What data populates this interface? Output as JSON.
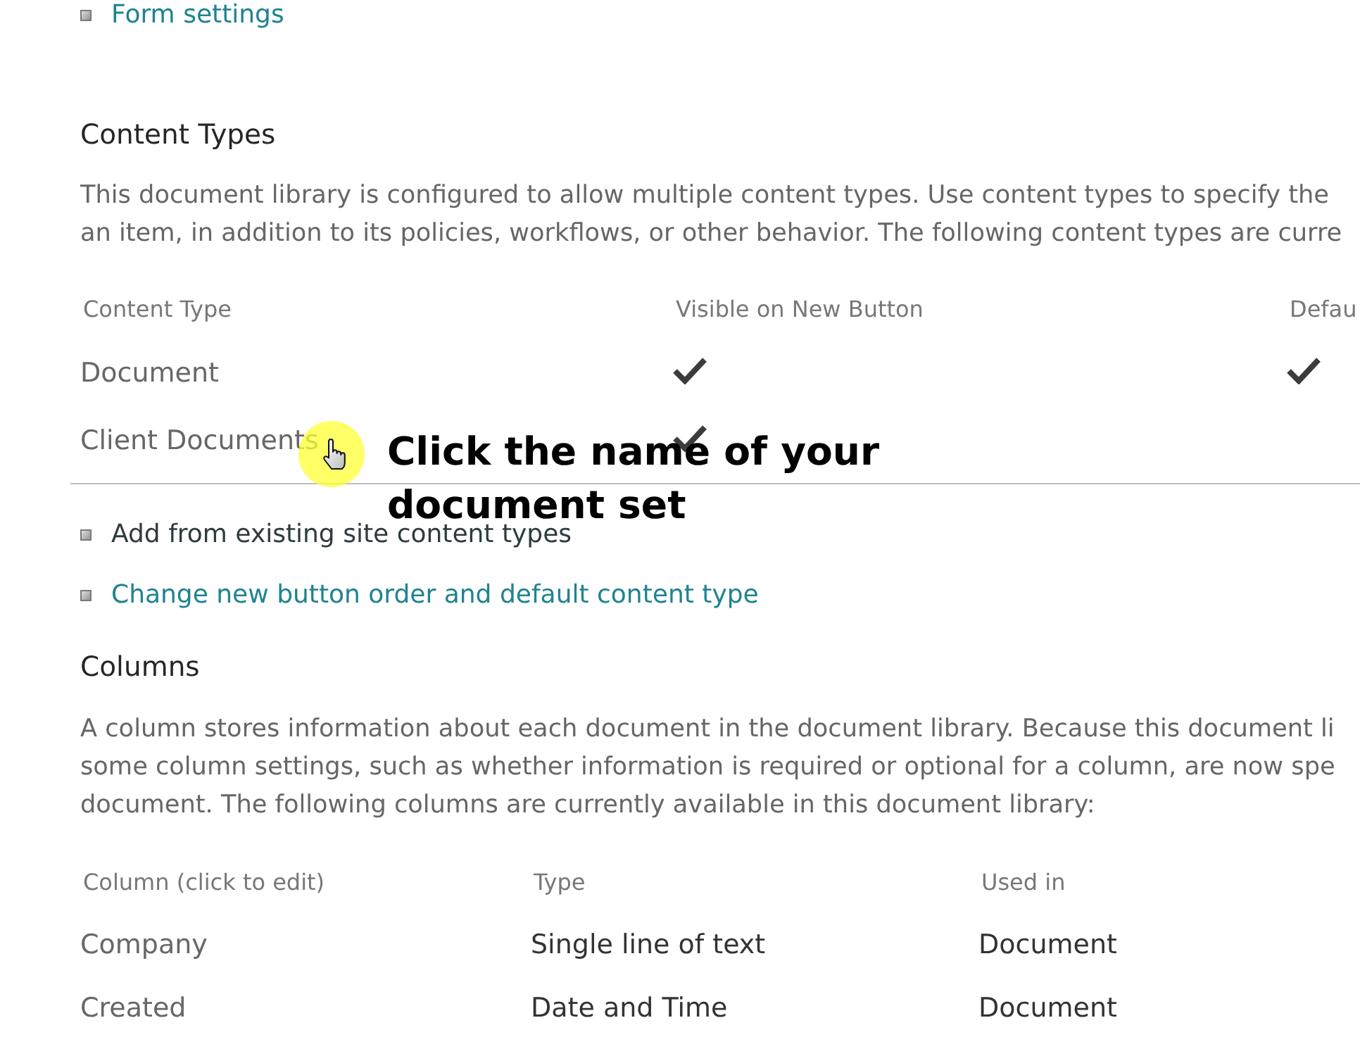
{
  "form_settings_link": {
    "label": "Form settings",
    "visited": false
  },
  "content_types": {
    "heading": "Content Types",
    "description_lines": [
      "This document library is configured to allow multiple content types. Use content types to specify the",
      "an item, in addition to its policies, workflows, or other behavior. The following content types are curre"
    ],
    "table": {
      "columns": [
        "Content Type",
        "Visible on New Button",
        "Defau"
      ],
      "rows": [
        {
          "name": "Document",
          "visible_on_new_button": true,
          "default": true
        },
        {
          "name": "Client Documents",
          "visible_on_new_button": true,
          "default": false
        }
      ]
    },
    "links": [
      {
        "label": "Add from existing site content types",
        "visited": true
      },
      {
        "label": "Change new button order and default content type",
        "visited": false
      }
    ]
  },
  "callout": {
    "text": "Click the name of your document set"
  },
  "columns_section": {
    "heading": "Columns",
    "description_lines": [
      "A column stores information about each document in the document library. Because this document li",
      "some column settings, such as whether information is required or optional for a column, are now spe",
      "document. The following columns are currently available in this document library:"
    ],
    "table": {
      "columns": [
        "Column (click to edit)",
        "Type",
        "Used in"
      ],
      "rows": [
        {
          "column": "Company",
          "type": "Single line of text",
          "used_in": "Document"
        },
        {
          "column": "Created",
          "type": "Date and Time",
          "used_in": "Document"
        }
      ]
    }
  }
}
